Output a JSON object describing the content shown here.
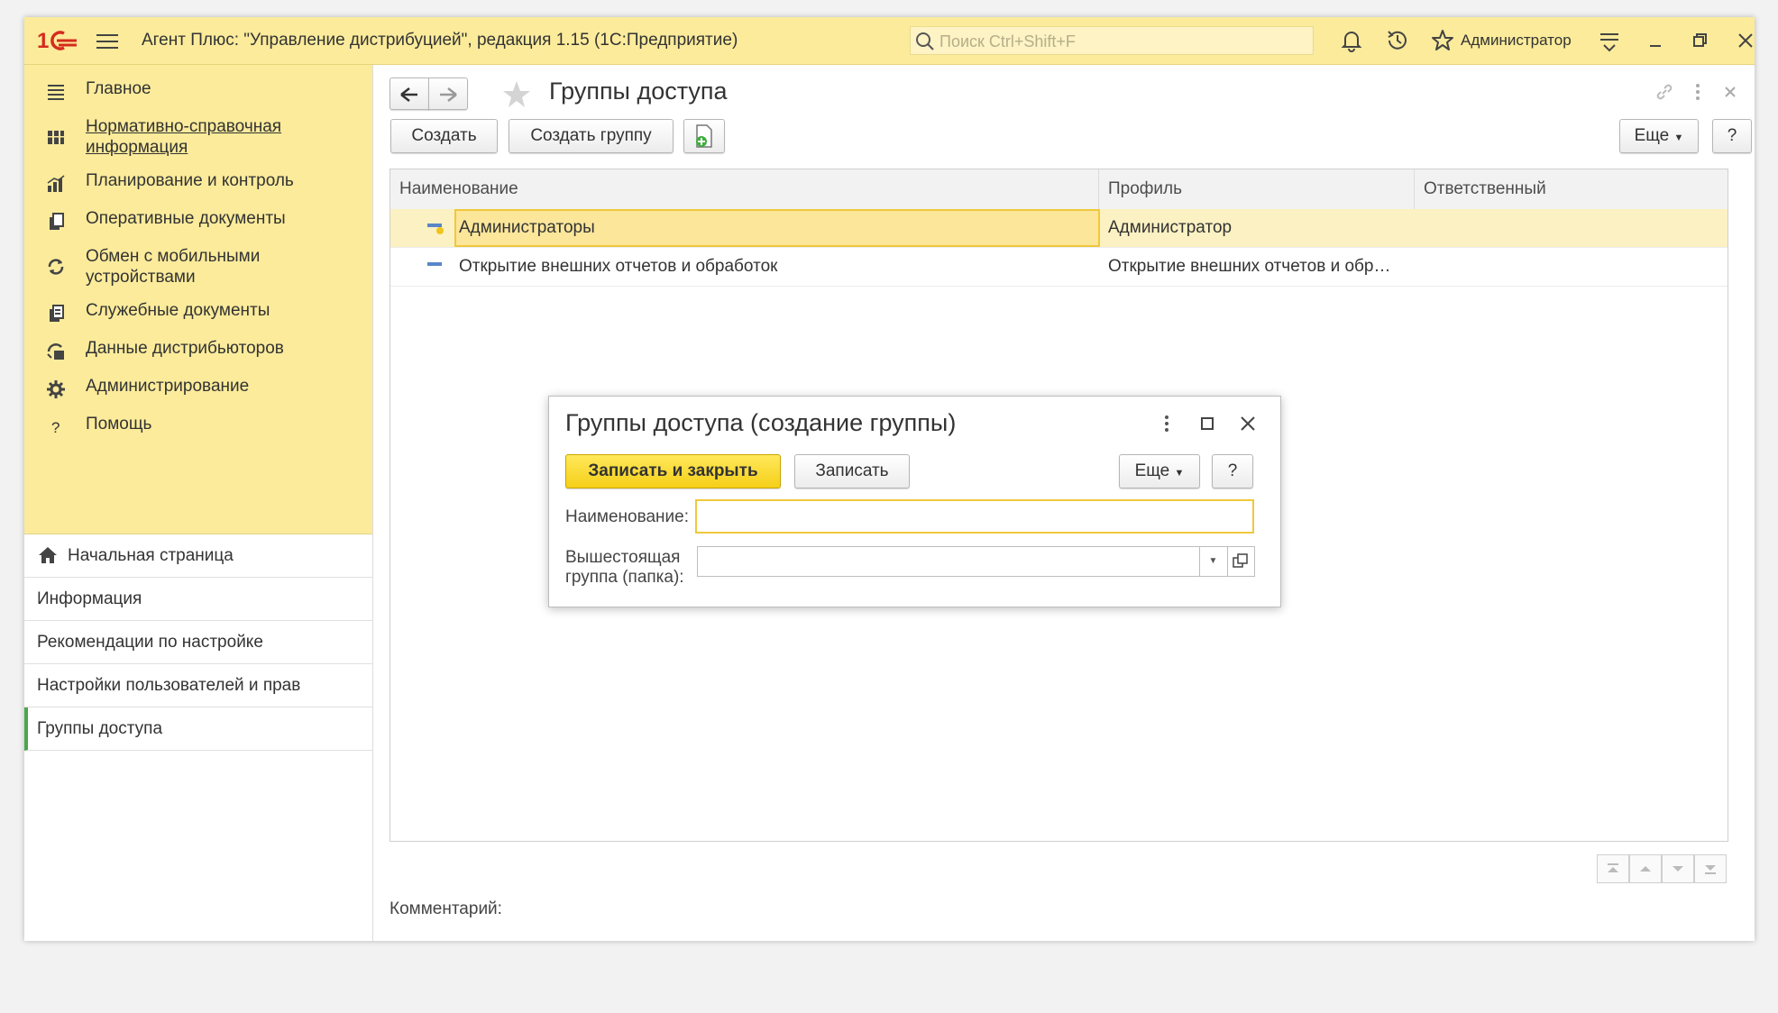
{
  "titlebar": {
    "app_title": "Агент Плюс: \"Управление дистрибуцией\", редакция 1.15  (1С:Предприятие)",
    "search_placeholder": "Поиск Ctrl+Shift+F",
    "user": "Администратор"
  },
  "sections": [
    {
      "label": "Главное",
      "icon": "menu-lines-icon"
    },
    {
      "label": "Нормативно-справочная информация",
      "icon": "grid-book-icon"
    },
    {
      "label": "Планирование и контроль",
      "icon": "chart-icon"
    },
    {
      "label": "Оперативные документы",
      "icon": "documents-icon"
    },
    {
      "label": "Обмен с мобильными устройствами",
      "icon": "sync-icon"
    },
    {
      "label": "Служебные документы",
      "icon": "service-docs-icon"
    },
    {
      "label": "Данные дистрибьюторов",
      "icon": "distributor-icon"
    },
    {
      "label": "Администрирование",
      "icon": "gear-icon"
    },
    {
      "label": "Помощь",
      "icon": "question-icon"
    }
  ],
  "nav": [
    {
      "label": "Начальная страница",
      "icon": "home-icon"
    },
    {
      "label": "Информация"
    },
    {
      "label": "Рекомендации по настройке"
    },
    {
      "label": "Настройки пользователей и прав"
    },
    {
      "label": "Группы доступа"
    }
  ],
  "page": {
    "title": "Группы доступа",
    "create_label": "Создать",
    "create_group_label": "Создать группу",
    "more_label": "Еще",
    "help_label": "?",
    "comment_label": "Комментарий:"
  },
  "table": {
    "columns": [
      "Наименование",
      "Профиль",
      "Ответственный"
    ],
    "rows": [
      {
        "name": "Администраторы",
        "profile": "Администратор",
        "responsible": ""
      },
      {
        "name": "Открытие внешних отчетов и обработок",
        "profile": "Открытие внешних отчетов и обр…",
        "responsible": ""
      }
    ]
  },
  "modal": {
    "title": "Группы доступа (создание группы)",
    "save_close_label": "Записать и закрыть",
    "save_label": "Записать",
    "more_label": "Еще",
    "help_label": "?",
    "name_label": "Наименование:",
    "name_value": "",
    "parent_label_1": "Вышестоящая",
    "parent_label_2": "группа (папка):",
    "parent_value": ""
  },
  "colors": {
    "accent_yellow": "#fbeb9b",
    "primary_button": "#f5cf18",
    "selected_row": "#fbf1c2",
    "logo_red": "#d52b1e"
  }
}
